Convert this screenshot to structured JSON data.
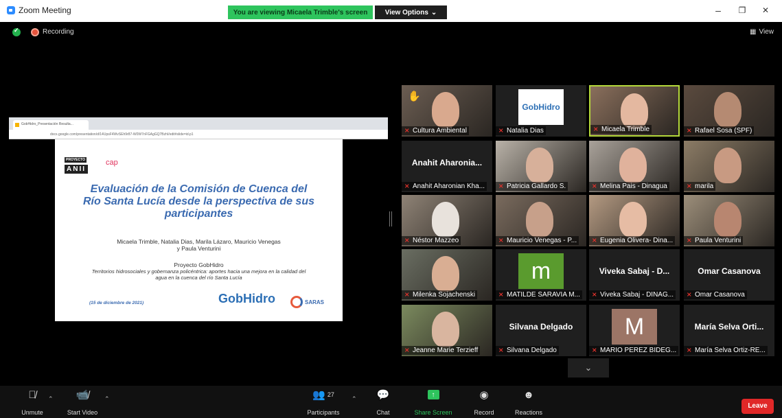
{
  "window": {
    "title": "Zoom Meeting",
    "viewing_banner": "You are viewing Micaela Trimble's screen",
    "view_options": "View Options",
    "controls": [
      "–",
      "❐",
      "✕"
    ]
  },
  "status": {
    "recording_label": "Recording",
    "view_label": "View"
  },
  "slide": {
    "browser_tab": "GobHidro_Presentación Resulta...",
    "browser_url": "docs.google.com/presentation/d/14UpsF4WvSEh9r87-W0W7nFGAgGQ7BzhI/edit#slide=id.p1",
    "logo_top": "PROYECTO",
    "logo_main": "ANII",
    "cap_logo": "cap",
    "title": "Evaluación de la Comisión de Cuenca del Río Santa Lucía desde la perspectiva de sus participantes",
    "authors": "Micaela Trimble, Natalia Dias, Marila Lázaro, Mauricio Venegas y Paula Venturini",
    "project": "Proyecto GobHidro",
    "description": "Territorios hidrosociales y gobernanza policéntrica: aportes hacia una mejora en la calidad del agua en la cuenca del río Santa Lucía",
    "date": "(15 de diciembre de 2021)",
    "gobhidro_logo": "GobHidro",
    "saras_logo": "SARAS"
  },
  "participants": [
    {
      "name": "Cultura Ambiental",
      "type": "video",
      "hand": true
    },
    {
      "name": "Natalia Dias",
      "type": "logo",
      "logo": "GobHidro"
    },
    {
      "name": "Micaela Trimble",
      "type": "video",
      "active": true
    },
    {
      "name": "Rafael Sosa (SPF)",
      "type": "video"
    },
    {
      "name": "Anahit Aharonian Kha...",
      "type": "name",
      "big": "Anahit Aharonia..."
    },
    {
      "name": "Patricia Gallardo S.",
      "type": "video"
    },
    {
      "name": "Melina Pais - Dinagua",
      "type": "video"
    },
    {
      "name": "marila",
      "type": "video"
    },
    {
      "name": "Néstor Mazzeo",
      "type": "video"
    },
    {
      "name": "Mauricio Venegas - P...",
      "type": "video"
    },
    {
      "name": "Eugenia Olivera- Dina...",
      "type": "video"
    },
    {
      "name": "Paula Venturini",
      "type": "video"
    },
    {
      "name": "Milenka Sojachenski",
      "type": "video"
    },
    {
      "name": "MATILDE SARAVIA M...",
      "type": "avatar",
      "letter": "m",
      "color": "#5a9b2e"
    },
    {
      "name": "Viveka Sabaj - DINAG...",
      "type": "name",
      "big": "Viveka Sabaj - D..."
    },
    {
      "name": "Omar Casanova",
      "type": "name",
      "big": "Omar Casanova"
    },
    {
      "name": "Jeanne Marie Terzieff",
      "type": "video"
    },
    {
      "name": "Silvana Delgado",
      "type": "name",
      "big": "Silvana Delgado"
    },
    {
      "name": "MARIO PEREZ BIDEG...",
      "type": "avatar",
      "letter": "M",
      "color": "#9c7566"
    },
    {
      "name": "María Selva Ortiz-RE...",
      "type": "name",
      "big": "María Selva Orti..."
    }
  ],
  "toolbar": {
    "unmute": "Unmute",
    "start_video": "Start Video",
    "participants": "Participants",
    "participant_count": "27",
    "chat": "Chat",
    "share_screen": "Share Screen",
    "record": "Record",
    "reactions": "Reactions",
    "leave": "Leave"
  },
  "colors": {
    "banner_green": "#2ec45d",
    "active_border": "#b4d83a",
    "leave_red": "#e02828",
    "mute_red": "#e0322c"
  }
}
